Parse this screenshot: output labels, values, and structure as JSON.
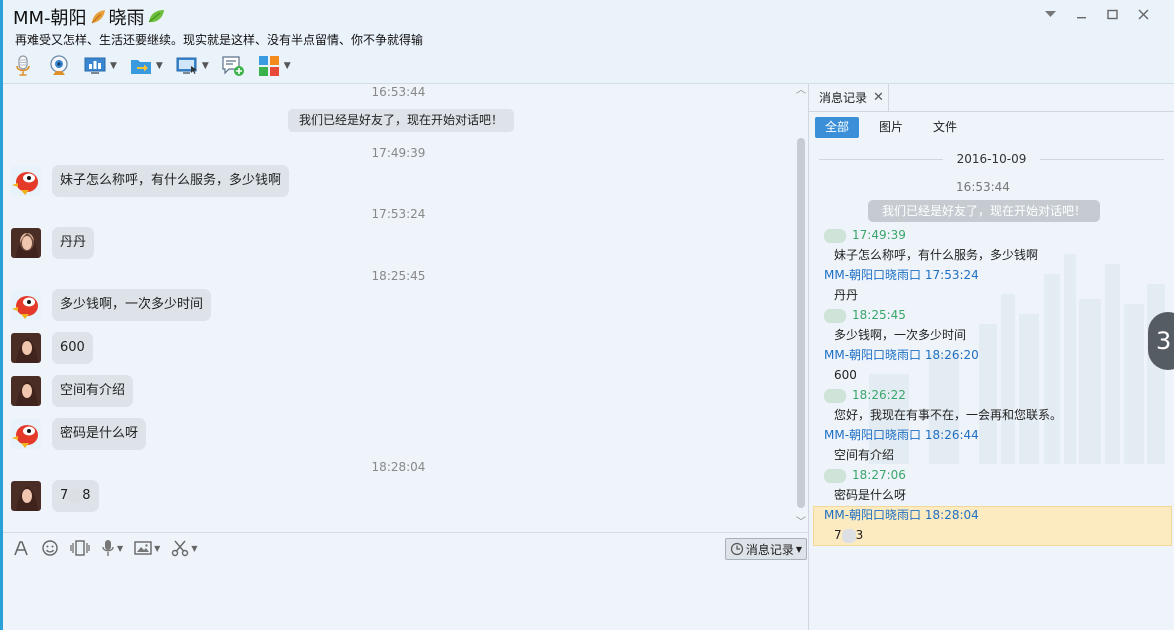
{
  "window": {
    "contact_name_part1": "MM-朝阳",
    "contact_name_part2": "晓雨",
    "signature": "再难受又怎样、生活还要继续。现实就是这样、没有半点留情、你不争就得输",
    "controls": [
      "dropdown",
      "minimize",
      "maximize",
      "close"
    ]
  },
  "toolbar": {
    "items": [
      {
        "name": "voice-call",
        "icon": "microphone-icon"
      },
      {
        "name": "video-call",
        "icon": "webcam-icon"
      },
      {
        "name": "remote-assist",
        "icon": "presentation-icon"
      },
      {
        "name": "send-file",
        "icon": "folder-arrow-icon"
      },
      {
        "name": "screen-share",
        "icon": "monitor-icon"
      },
      {
        "name": "group-chat",
        "icon": "add-chat-icon"
      },
      {
        "name": "app-center",
        "icon": "grid-apps-icon"
      }
    ]
  },
  "chat": {
    "timestamps": [
      "16:53:44",
      "17:49:39",
      "17:53:24",
      "18:25:45",
      "18:28:04"
    ],
    "system_message": "我们已经是好友了，现在开始对话吧！",
    "messages": [
      {
        "sender": "other",
        "text": "妹子怎么称呼，有什么服务，多少钱啊"
      },
      {
        "sender": "self",
        "text": "丹丹"
      },
      {
        "sender": "other",
        "text": "多少钱啊，一次多少时间"
      },
      {
        "sender": "self",
        "text": "600"
      },
      {
        "sender": "self",
        "text": "空间有介绍"
      },
      {
        "sender": "other",
        "text": "密码是什么呀"
      },
      {
        "sender": "self",
        "text_prefix": "7",
        "text_suffix": "8"
      }
    ]
  },
  "input_tools": {
    "items": [
      "font-icon",
      "emoji-icon",
      "shake-icon",
      "voice-message-icon",
      "image-icon",
      "screenshot-icon"
    ],
    "history_button": "消息记录"
  },
  "history": {
    "tab_label": "消息记录",
    "filters": [
      "全部",
      "图片",
      "文件"
    ],
    "active_filter": "全部",
    "date": "2016-10-09",
    "system_time": "16:53:44",
    "system_message": "我们已经是好友了，现在开始对话吧！",
    "records": [
      {
        "sender": "other",
        "name": "",
        "time": "17:49:39",
        "text": "妹子怎么称呼，有什么服务，多少钱啊"
      },
      {
        "sender": "self",
        "name": "MM-朝阳口晓雨口",
        "time": "17:53:24",
        "text": "丹丹"
      },
      {
        "sender": "other",
        "name": "",
        "time": "18:25:45",
        "text": "多少钱啊，一次多少时间"
      },
      {
        "sender": "self",
        "name": "MM-朝阳口晓雨口",
        "time": "18:26:20",
        "text": "600"
      },
      {
        "sender": "other",
        "name": "",
        "time": "18:26:22",
        "text": "您好，我现在有事不在，一会再和您联系。"
      },
      {
        "sender": "self",
        "name": "MM-朝阳口晓雨口",
        "time": "18:26:44",
        "text": "空间有介绍"
      },
      {
        "sender": "other",
        "name": "",
        "time": "18:27:06",
        "text": "密码是什么呀"
      },
      {
        "sender": "self",
        "name": "MM-朝阳口晓雨口",
        "time": "18:28:04",
        "text_prefix": "7",
        "text_suffix": "3"
      }
    ]
  },
  "side_pill": "3",
  "colors": {
    "accent": "#2aa0d8",
    "active_filter": "#3b8fd8",
    "self_name": "#1f6fc4",
    "other_name": "#3aa66a",
    "highlight": "#fcebc0"
  }
}
